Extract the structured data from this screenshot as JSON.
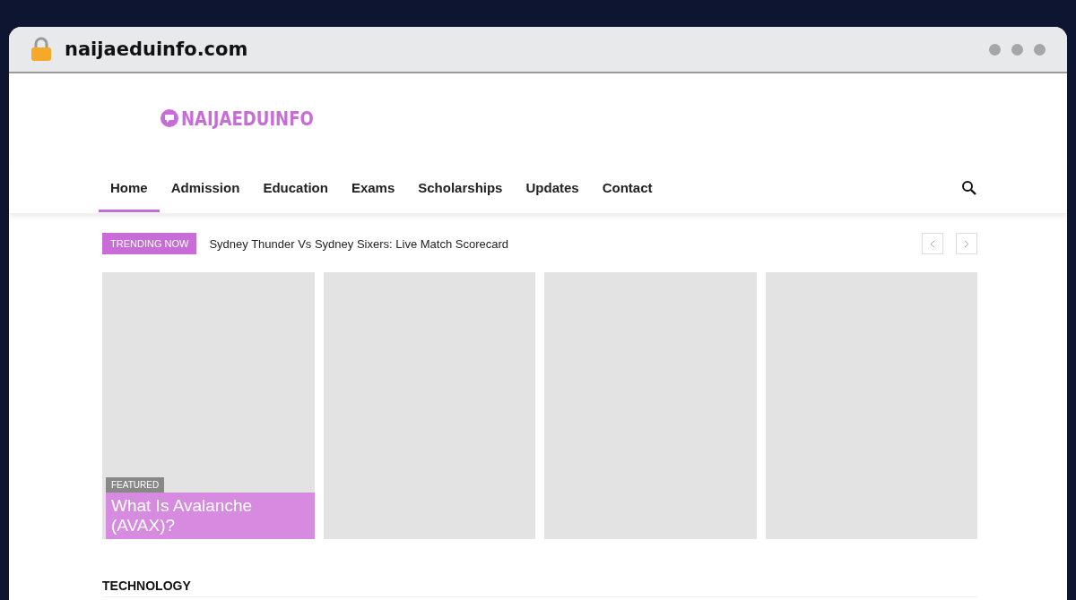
{
  "browser": {
    "url": "naijaeduinfo.com"
  },
  "logo": {
    "text": "NAIJAEDUINFO"
  },
  "nav": [
    {
      "label": "Home",
      "selected": true
    },
    {
      "label": "Admission",
      "selected": false
    },
    {
      "label": "Education",
      "selected": false
    },
    {
      "label": "Exams",
      "selected": false
    },
    {
      "label": "Scholarships",
      "selected": false
    },
    {
      "label": "Updates",
      "selected": false
    },
    {
      "label": "Contact",
      "selected": false
    }
  ],
  "trending": {
    "badge": "TRENDING NOW",
    "headline": "Sydney Thunder Vs Sydney Sixers: Live Match Scorecard"
  },
  "cards": [
    {
      "kind": "featured",
      "badge": "FEATURED",
      "title": "What Is Avalanche (AVAX)?"
    },
    {
      "kind": "blank"
    },
    {
      "kind": "blank"
    },
    {
      "kind": "blank"
    }
  ],
  "section": {
    "title": "TECHNOLOGY"
  }
}
